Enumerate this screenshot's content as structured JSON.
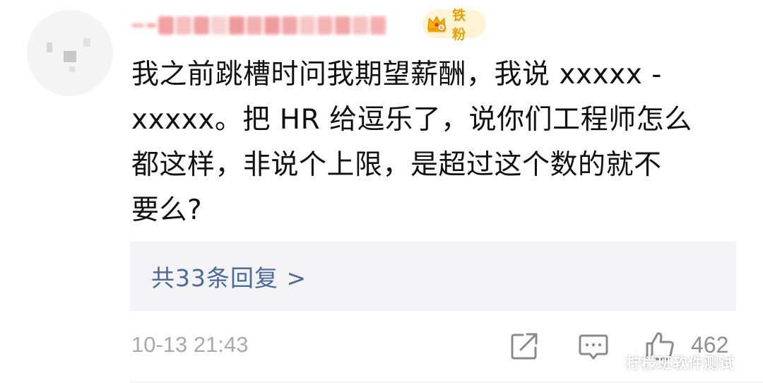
{
  "comment": {
    "author_badge_label": "铁粉",
    "body": "我之前跳槽时问我期望薪酬，我说 xxxxx -\nxxxxx。把 HR 给逗乐了，说你们工程师怎么\n都这样，非说个上限，是超过这个数的就不\n要么?",
    "replies_link": "共33条回复 >",
    "timestamp": "10-13 21:43",
    "like_count": "462"
  },
  "watermark": "柠檬班软件测试",
  "colors": {
    "badge_text": "#e8a200",
    "badge_bg": "#fff3d6",
    "link_blue": "#4a6a99",
    "reply_box_bg": "#f3f3f5",
    "meta_gray": "#a9a9a9"
  },
  "icons": {
    "badge": "crown-icon",
    "share": "share-icon",
    "comment": "comment-icon",
    "like": "thumbs-up-icon"
  }
}
